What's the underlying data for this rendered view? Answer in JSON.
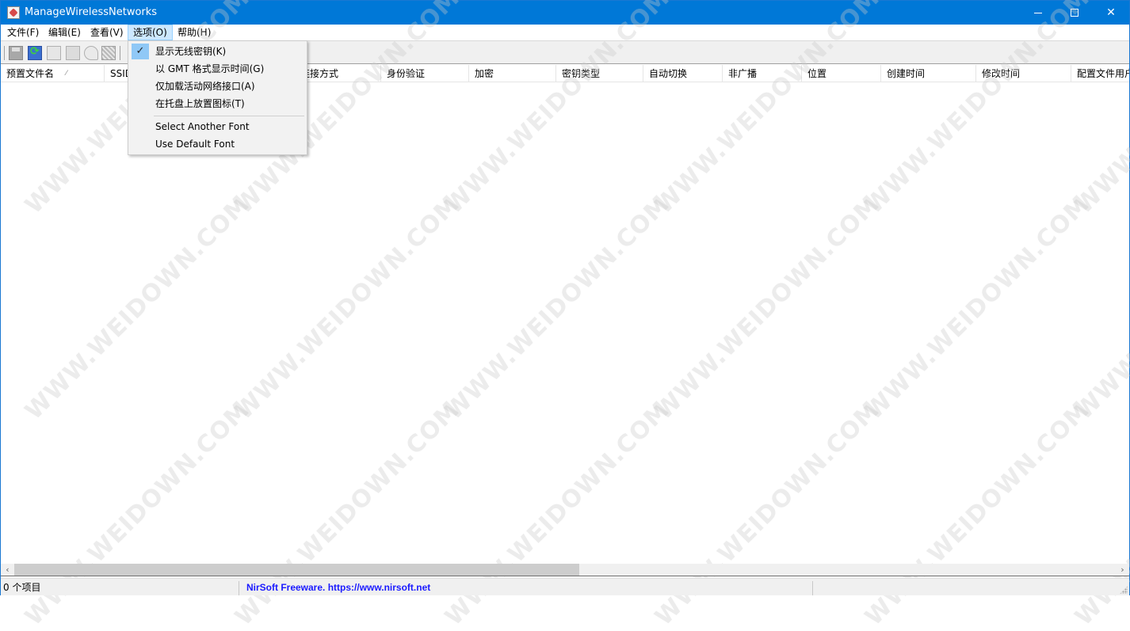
{
  "window": {
    "title": "ManageWirelessNetworks",
    "controls": {
      "minimize": "minimize",
      "maximize": "maximize",
      "close": "✕"
    }
  },
  "menubar": {
    "items": [
      {
        "label": "文件(F)"
      },
      {
        "label": "编辑(E)"
      },
      {
        "label": "查看(V)"
      },
      {
        "label": "选项(O)",
        "active": true
      },
      {
        "label": "帮助(H)"
      }
    ]
  },
  "toolbar": {
    "buttons": [
      {
        "icon": "save-icon",
        "enabled": false
      },
      {
        "icon": "refresh-icon",
        "enabled": true
      },
      {
        "icon": "copy-icon",
        "enabled": false
      },
      {
        "icon": "properties-icon",
        "enabled": false
      },
      {
        "icon": "find-icon",
        "enabled": false
      },
      {
        "icon": "qr-code-icon",
        "enabled": false
      }
    ]
  },
  "options_menu": {
    "items": [
      {
        "label": "显示无线密钥(K)",
        "checked": true
      },
      {
        "label": "以 GMT 格式显示时间(G)",
        "checked": false
      },
      {
        "label": "仅加载活动网络接口(A)",
        "checked": false
      },
      {
        "label": "在托盘上放置图标(T)",
        "checked": false
      },
      {
        "separator": true
      },
      {
        "label": "Select Another Font"
      },
      {
        "label": "Use Default Font"
      }
    ],
    "check_glyph": "✓"
  },
  "list": {
    "columns": [
      {
        "label": "预置文件名",
        "sorted": true
      },
      {
        "label": "SSID"
      },
      {
        "label": "连接方式"
      },
      {
        "label": "身份验证"
      },
      {
        "label": "加密"
      },
      {
        "label": "密钥类型"
      },
      {
        "label": "自动切换"
      },
      {
        "label": "非广播"
      },
      {
        "label": "位置"
      },
      {
        "label": "创建时间"
      },
      {
        "label": "修改时间"
      },
      {
        "label": "配置文件用户"
      }
    ],
    "sort_glyph": "⁄",
    "rows": []
  },
  "scrollbar": {
    "left_arrow": "‹",
    "right_arrow": "›",
    "visible_fraction": 0.5
  },
  "statusbar": {
    "item_count": "0 个项目",
    "credit": "NirSoft Freeware. https://www.nirsoft.net"
  },
  "watermark": "WWW.WEIDOWN.COM",
  "colors": {
    "titlebar": "#0078d7",
    "menu_active": "#cce8ff",
    "check_highlight": "#90c8f6",
    "link": "#1a1aff"
  }
}
